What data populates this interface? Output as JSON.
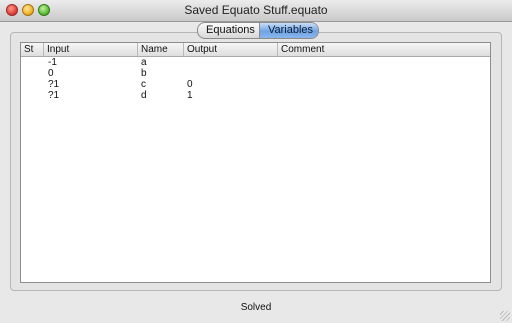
{
  "window": {
    "title": "Saved Equato Stuff.equato"
  },
  "tabs": {
    "items": [
      {
        "label": "Equations"
      },
      {
        "label": "Variables"
      }
    ],
    "active": "Variables"
  },
  "table": {
    "columns": [
      "St",
      "Input",
      "Name",
      "Output",
      "Comment"
    ],
    "rows": [
      {
        "st": "",
        "input": "-1",
        "name": "a",
        "output": "",
        "comment": ""
      },
      {
        "st": "",
        "input": "0",
        "name": "b",
        "output": "",
        "comment": ""
      },
      {
        "st": "",
        "input": "?1",
        "name": "c",
        "output": "0",
        "comment": ""
      },
      {
        "st": "",
        "input": "?1",
        "name": "d",
        "output": "1",
        "comment": ""
      }
    ]
  },
  "status": {
    "text": "Solved"
  },
  "colors": {
    "tab_active": "#6fa3e3",
    "close": "#e0443a",
    "minimize": "#f0b42a",
    "zoom": "#5fbf3a"
  }
}
